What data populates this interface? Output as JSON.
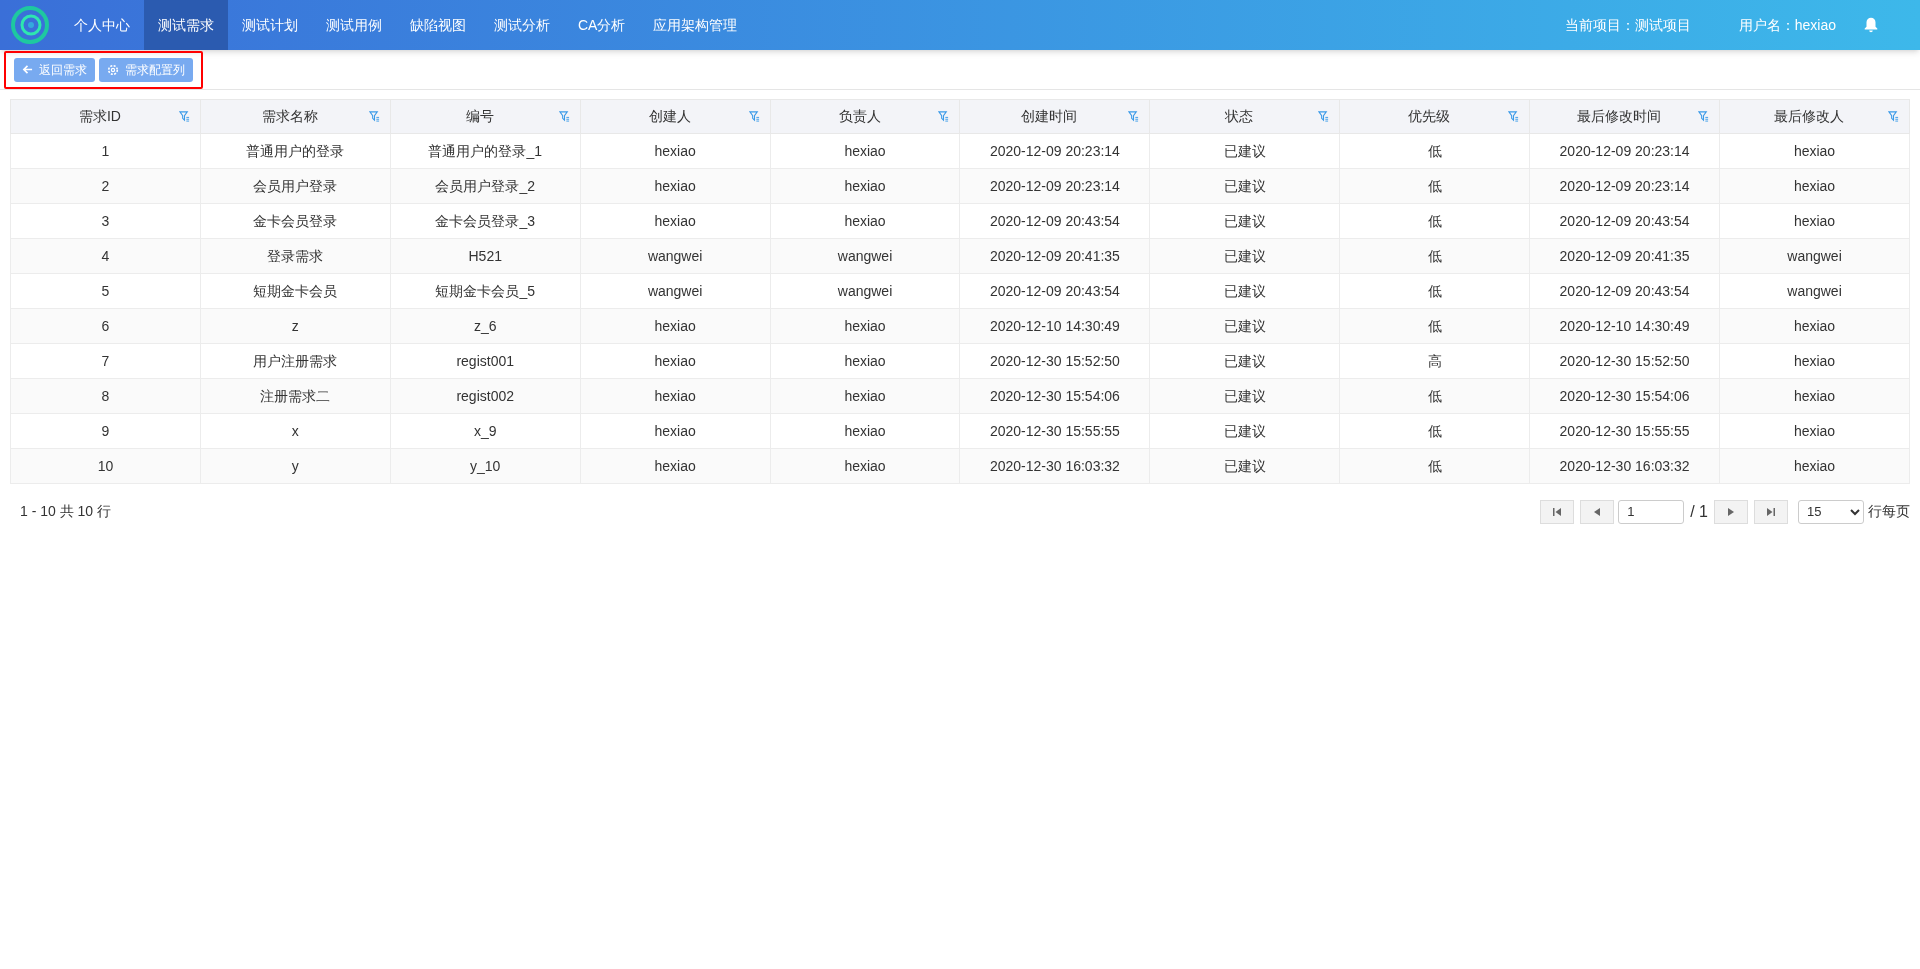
{
  "nav": {
    "items": [
      {
        "label": "个人中心",
        "selected": false
      },
      {
        "label": "测试需求",
        "selected": true
      },
      {
        "label": "测试计划",
        "selected": false
      },
      {
        "label": "测试用例",
        "selected": false
      },
      {
        "label": "缺陷视图",
        "selected": false
      },
      {
        "label": "测试分析",
        "selected": false
      },
      {
        "label": "CA分析",
        "selected": false
      },
      {
        "label": "应用架构管理",
        "selected": false
      }
    ],
    "project": "当前项目：测试项目",
    "user": "用户名：hexiao"
  },
  "toolbar": {
    "highlighted": true,
    "buttons": [
      {
        "label": "返回需求",
        "kind": "back"
      },
      {
        "label": "需求配置列",
        "kind": "settings"
      }
    ]
  },
  "table": {
    "columns": [
      "需求ID",
      "需求名称",
      "编号",
      "创建人",
      "负责人",
      "创建时间",
      "状态",
      "优先级",
      "最后修改时间",
      "最后修改人"
    ],
    "rows": [
      [
        "1",
        "普通用户的登录",
        "普通用户的登录_1",
        "hexiao",
        "hexiao",
        "2020-12-09 20:23:14",
        "已建议",
        "低",
        "2020-12-09 20:23:14",
        "hexiao"
      ],
      [
        "2",
        "会员用户登录",
        "会员用户登录_2",
        "hexiao",
        "hexiao",
        "2020-12-09 20:23:14",
        "已建议",
        "低",
        "2020-12-09 20:23:14",
        "hexiao"
      ],
      [
        "3",
        "金卡会员登录",
        "金卡会员登录_3",
        "hexiao",
        "hexiao",
        "2020-12-09 20:43:54",
        "已建议",
        "低",
        "2020-12-09 20:43:54",
        "hexiao"
      ],
      [
        "4",
        "登录需求",
        "H521",
        "wangwei",
        "wangwei",
        "2020-12-09 20:41:35",
        "已建议",
        "低",
        "2020-12-09 20:41:35",
        "wangwei"
      ],
      [
        "5",
        "短期金卡会员",
        "短期金卡会员_5",
        "wangwei",
        "wangwei",
        "2020-12-09 20:43:54",
        "已建议",
        "低",
        "2020-12-09 20:43:54",
        "wangwei"
      ],
      [
        "6",
        "z",
        "z_6",
        "hexiao",
        "hexiao",
        "2020-12-10 14:30:49",
        "已建议",
        "低",
        "2020-12-10 14:30:49",
        "hexiao"
      ],
      [
        "7",
        "用户注册需求",
        "regist001",
        "hexiao",
        "hexiao",
        "2020-12-30 15:52:50",
        "已建议",
        "高",
        "2020-12-30 15:52:50",
        "hexiao"
      ],
      [
        "8",
        "注册需求二",
        "regist002",
        "hexiao",
        "hexiao",
        "2020-12-30 15:54:06",
        "已建议",
        "低",
        "2020-12-30 15:54:06",
        "hexiao"
      ],
      [
        "9",
        "x",
        "x_9",
        "hexiao",
        "hexiao",
        "2020-12-30 15:55:55",
        "已建议",
        "低",
        "2020-12-30 15:55:55",
        "hexiao"
      ],
      [
        "10",
        "y",
        "y_10",
        "hexiao",
        "hexiao",
        "2020-12-30 16:03:32",
        "已建议",
        "低",
        "2020-12-30 16:03:32",
        "hexiao"
      ]
    ]
  },
  "pager": {
    "summary": "1 - 10 共 10 行",
    "page": "1",
    "total": "/ 1",
    "page_size": "15",
    "per_page_label": "行每页"
  }
}
